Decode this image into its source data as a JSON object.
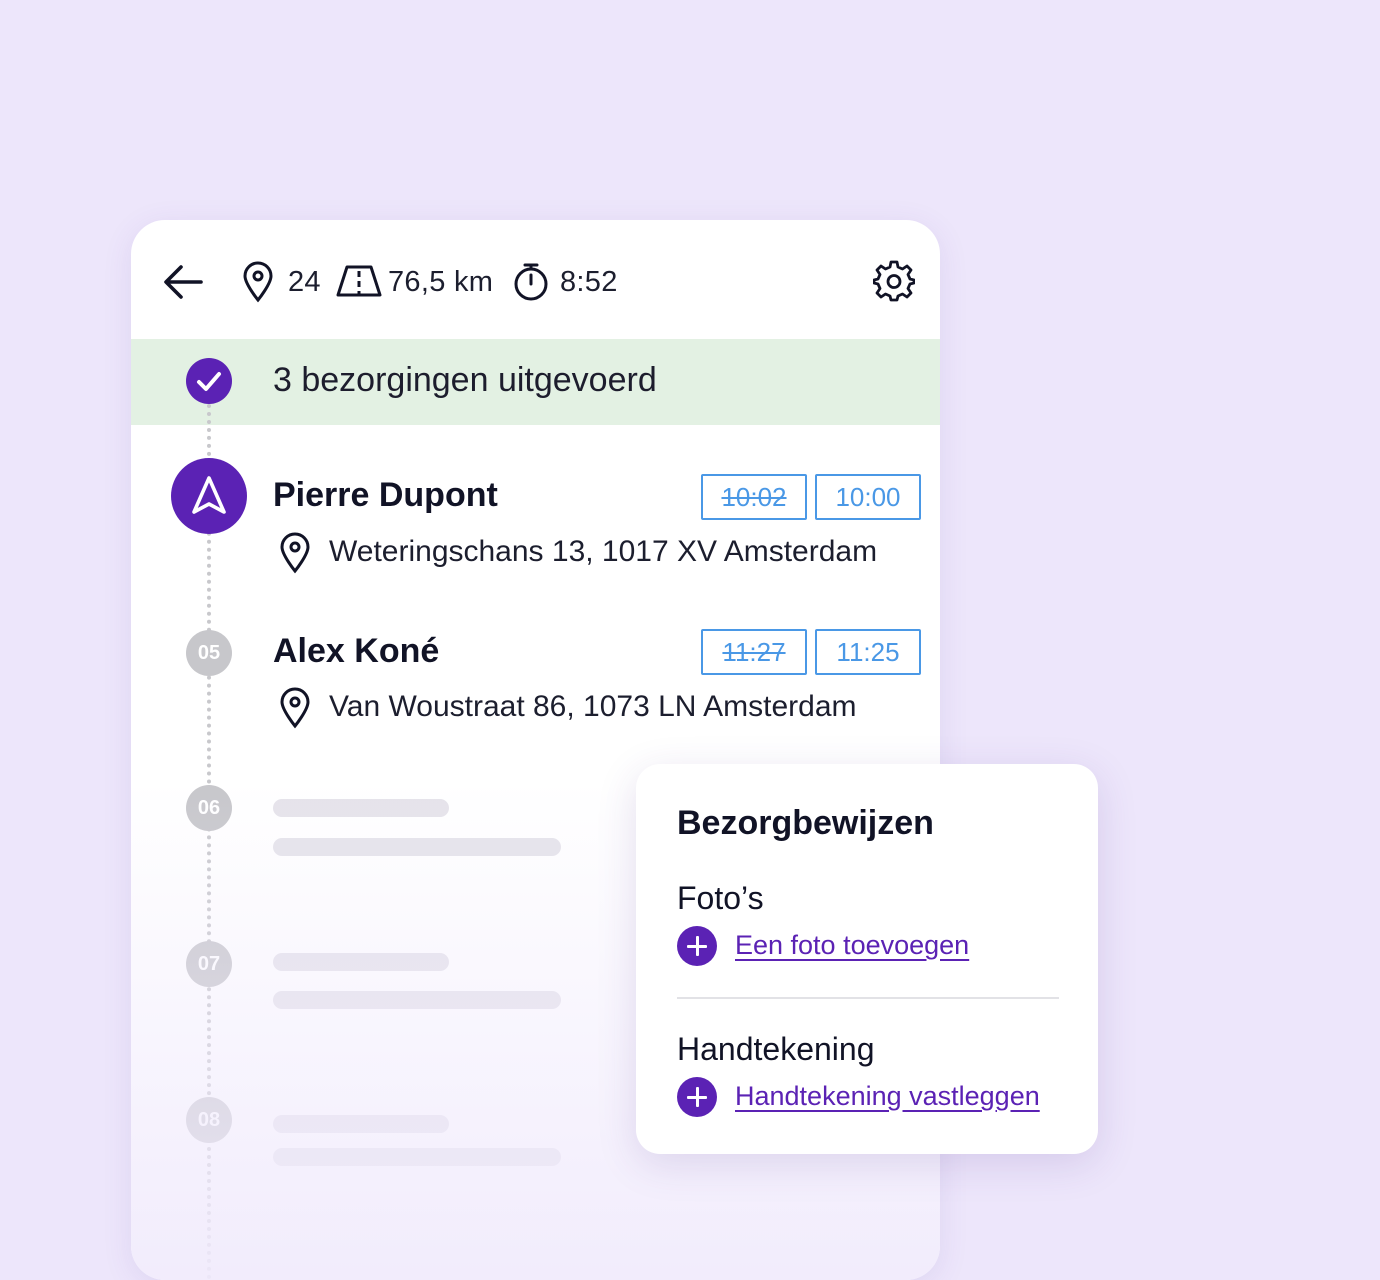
{
  "header": {
    "stops_count": "24",
    "distance": "76,5 km",
    "duration": "8:52"
  },
  "banner": {
    "text": "3 bezorgingen uitgevoerd"
  },
  "stops": [
    {
      "name": "Pierre Dupont",
      "address": "Weteringschans 13, 1017 XV Amsterdam",
      "time_old": "10:02",
      "time_new": "10:00",
      "icon": "navigation-arrow-icon"
    },
    {
      "number": "05",
      "name": "Alex Koné",
      "address": "Van Woustraat 86, 1073 LN Amsterdam",
      "time_old": "11:27",
      "time_new": "11:25"
    }
  ],
  "placeholder_stops": [
    {
      "number": "06"
    },
    {
      "number": "07"
    },
    {
      "number": "08"
    }
  ],
  "proof_panel": {
    "title": "Bezorgbewijzen",
    "photos_label": "Foto’s",
    "photos_action": "Een foto toevoegen",
    "signature_label": "Handtekening",
    "signature_action": "Handtekening vastleggen"
  },
  "colors": {
    "primary": "#5b22b4",
    "time_blue": "#4a98e6",
    "banner_green": "#e3f1e3",
    "background": "#ede6fb"
  }
}
